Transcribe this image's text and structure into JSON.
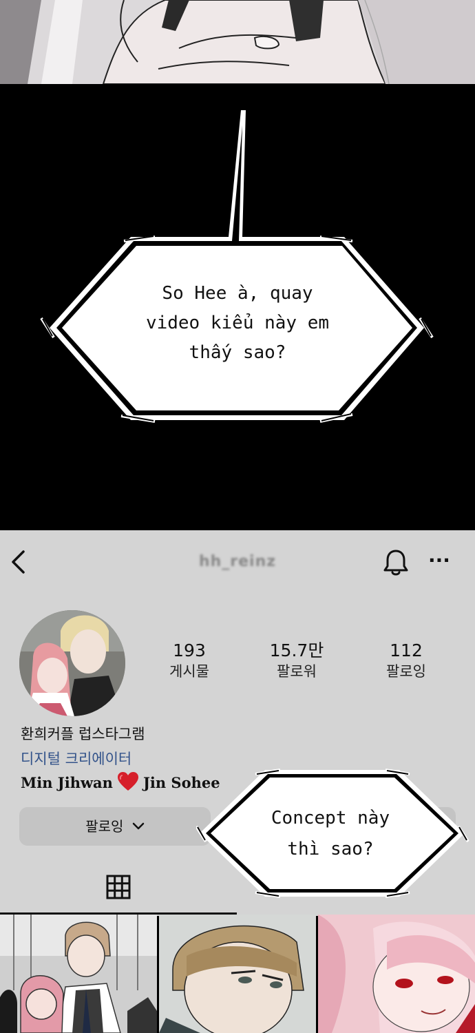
{
  "panel1": {
    "bubble_lines": [
      "So Hee à, quay",
      "video kiểu này em",
      "thấy sao?"
    ]
  },
  "profile": {
    "header": {
      "back_icon": "chevron-left-icon",
      "username": "hh_reinz",
      "bell_icon": "bell-icon",
      "more_icon": "more-dots-icon",
      "more_glyph": "···"
    },
    "stats": [
      {
        "value": "193",
        "label": "게시물"
      },
      {
        "value": "15.7만",
        "label": "팔로워"
      },
      {
        "value": "112",
        "label": "팔로잉"
      }
    ],
    "name": "환희커플 럽스타그램",
    "category": "디지털 크리에이터",
    "bio_left": "Min Jihwan",
    "bio_heart_icon": "heart-icon",
    "bio_heart_color": "#d61f2a",
    "bio_right": "Jin Sohee",
    "follow_button": "팔로잉",
    "follow_chevron_icon": "chevron-down-icon",
    "grid_icon": "grid-icon"
  },
  "overlay": {
    "bubble_lines": [
      "Concept này",
      "thì sao?"
    ]
  }
}
